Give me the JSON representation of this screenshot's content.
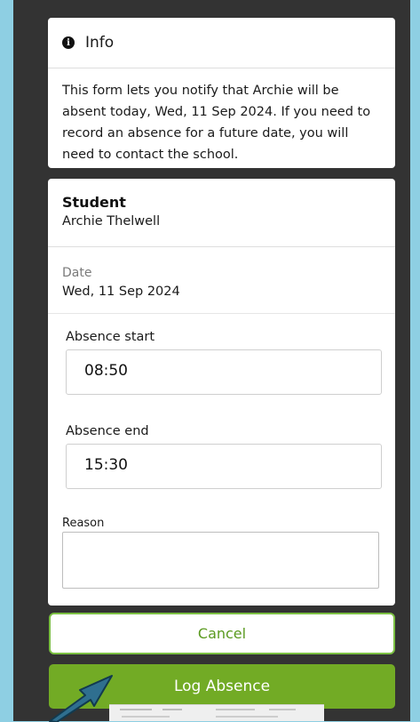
{
  "info": {
    "icon": "info-icon",
    "title": "Info",
    "message": "This form lets you notify that Archie will be absent today, Wed, 11 Sep 2024. If you need to record an absence for a future date, you will need to contact the school."
  },
  "form": {
    "student_label": "Student",
    "student_name": "Archie Thelwell",
    "date_label": "Date",
    "date_value": "Wed, 11 Sep 2024",
    "absence_start_label": "Absence start",
    "absence_start_value": "08:50",
    "absence_end_label": "Absence end",
    "absence_end_value": "15:30",
    "reason_label": "Reason",
    "reason_value": ""
  },
  "buttons": {
    "cancel_label": "Cancel",
    "log_label": "Log Absence"
  },
  "colors": {
    "accent_green": "#72ab25",
    "outline_green": "#7bc043",
    "background_blue": "#8ecfe3"
  }
}
